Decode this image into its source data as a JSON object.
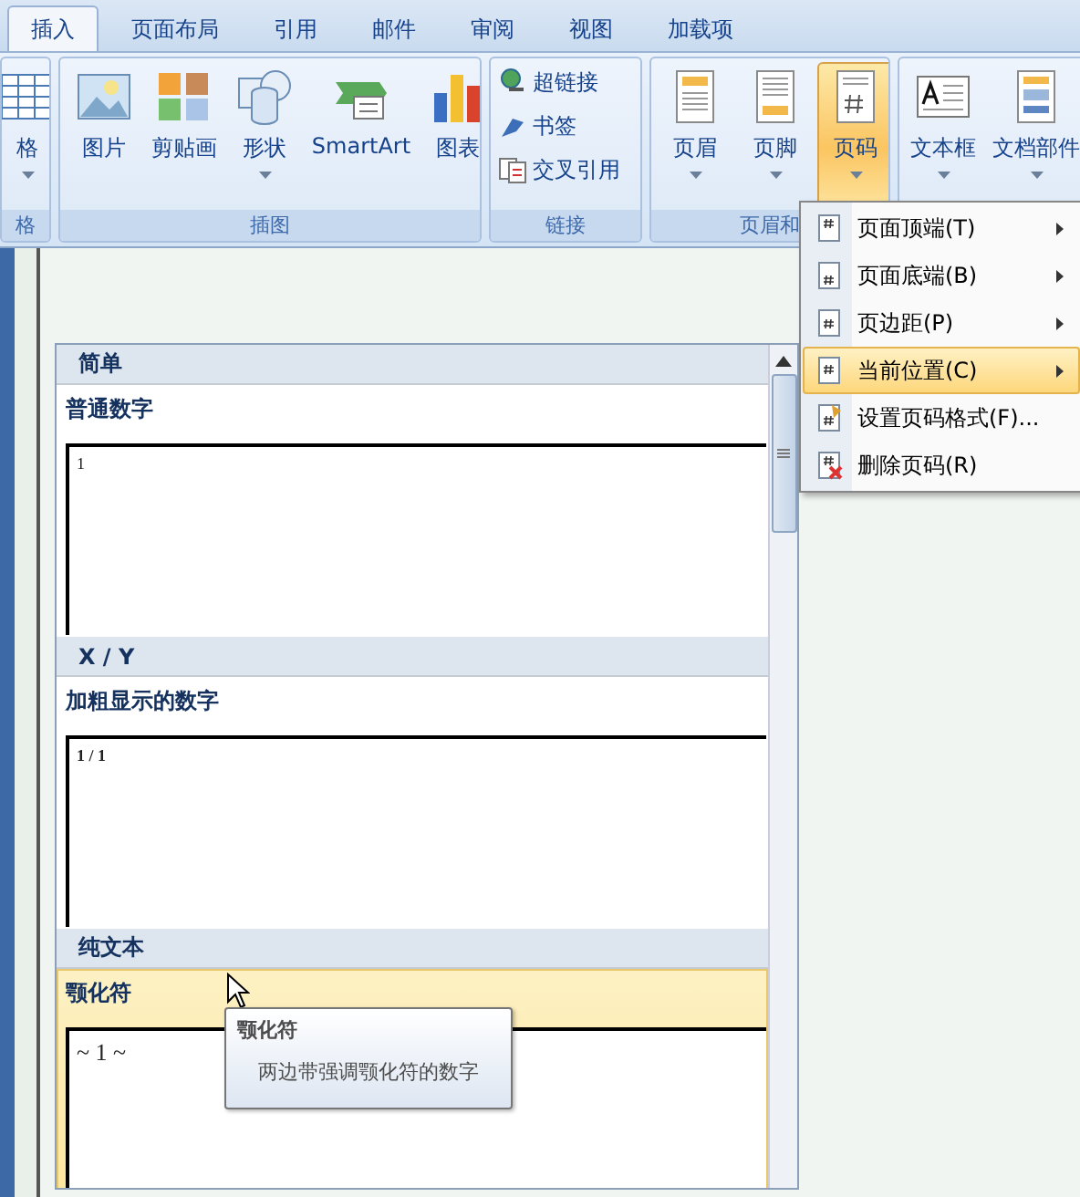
{
  "tabs": [
    {
      "label": "插入",
      "selected": true
    },
    {
      "label": "页面布局",
      "selected": false
    },
    {
      "label": "引用",
      "selected": false
    },
    {
      "label": "邮件",
      "selected": false
    },
    {
      "label": "审阅",
      "selected": false
    },
    {
      "label": "视图",
      "selected": false
    },
    {
      "label": "加载项",
      "selected": false
    }
  ],
  "ribbon_groups": [
    {
      "label": "格",
      "kind": "large",
      "buttons": [
        {
          "kind": "table",
          "label": "格",
          "dropdown": true,
          "selected": false
        }
      ]
    },
    {
      "label": "插图",
      "kind": "large",
      "buttons": [
        {
          "kind": "picture",
          "label": "图片",
          "dropdown": false,
          "selected": false
        },
        {
          "kind": "clipart",
          "label": "剪贴画",
          "dropdown": false,
          "selected": false
        },
        {
          "kind": "shapes",
          "label": "形状",
          "dropdown": true,
          "selected": false
        },
        {
          "kind": "smartart",
          "label": "SmartArt",
          "dropdown": false,
          "selected": false
        },
        {
          "kind": "chart",
          "label": "图表",
          "dropdown": false,
          "selected": false
        }
      ]
    },
    {
      "label": "链接",
      "kind": "small",
      "buttons": [
        {
          "kind": "hyperlink",
          "label": "超链接",
          "dropdown": false,
          "selected": false
        },
        {
          "kind": "bookmark",
          "label": "书签",
          "dropdown": false,
          "selected": false
        },
        {
          "kind": "crossref",
          "label": "交叉引用",
          "dropdown": false,
          "selected": false
        }
      ]
    },
    {
      "label": "页眉和",
      "kind": "large",
      "buttons": [
        {
          "kind": "header",
          "label": "页眉",
          "dropdown": true,
          "selected": false
        },
        {
          "kind": "footer",
          "label": "页脚",
          "dropdown": true,
          "selected": false
        },
        {
          "kind": "pagenumber",
          "label": "页码",
          "dropdown": true,
          "selected": true
        }
      ]
    },
    {
      "kind": "large",
      "buttons": [
        {
          "kind": "textbox",
          "label": "文本框",
          "dropdown": true,
          "selected": false
        },
        {
          "kind": "parts",
          "label": "文档部件",
          "dropdown": true,
          "selected": false
        }
      ]
    }
  ],
  "menu": [
    {
      "label": "页面顶端(T)",
      "submenu": true,
      "selected": false
    },
    {
      "label": "页面底端(B)",
      "submenu": true,
      "selected": false
    },
    {
      "label": "页边距(P)",
      "submenu": true,
      "selected": false
    },
    {
      "label": "当前位置(C)",
      "submenu": true,
      "selected": true
    },
    {
      "label": "设置页码格式(F)...",
      "submenu": false,
      "selected": false
    },
    {
      "label": "删除页码(R)",
      "submenu": false,
      "selected": false
    }
  ],
  "gallery": {
    "sections": [
      {
        "header": "简单",
        "items": [
          {
            "name": "普通数字",
            "preview": "1",
            "bold": false,
            "selected": false
          }
        ]
      },
      {
        "header": "X / Y",
        "items": [
          {
            "name": "加粗显示的数字",
            "preview": "1 / 1",
            "bold": true,
            "selected": false
          }
        ]
      },
      {
        "header": "纯文本",
        "items": [
          {
            "name": "颚化符",
            "preview": "~ 1 ~",
            "bold": false,
            "selected": true
          }
        ]
      }
    ]
  },
  "tooltip": {
    "title": "颚化符",
    "description": "两边带强调颚化符的数字"
  }
}
